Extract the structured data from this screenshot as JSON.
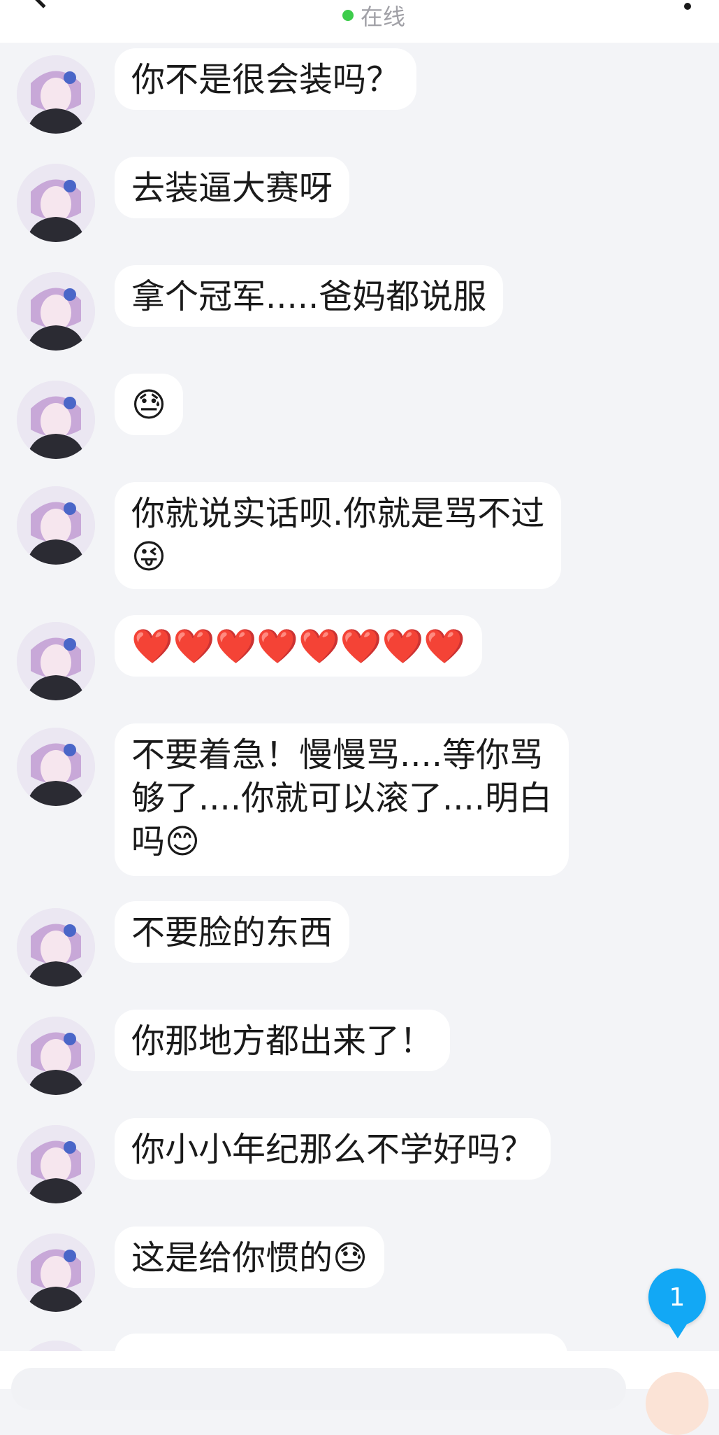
{
  "header": {
    "status_text": "在线"
  },
  "messages": [
    {
      "text": "你不是很会装吗？"
    },
    {
      "text": "去装逼大赛呀"
    },
    {
      "text": "拿个冠军.....爸妈都说服"
    },
    {
      "text": "😓"
    },
    {
      "text": "你就说实话呗.你就是骂不过\n😜"
    },
    {
      "text": "❤️❤️❤️❤️❤️❤️❤️❤️"
    },
    {
      "text": "不要着急！慢慢骂....等你骂\n够了....你就可以滚了....明白\n吗😊"
    },
    {
      "text": "不要脸的东西"
    },
    {
      "text": "你那地方都出来了！"
    },
    {
      "text": "你小小年纪那么不学好吗？"
    },
    {
      "text": "这是给你惯的😓"
    }
  ],
  "unread_badge": {
    "count": "1"
  }
}
